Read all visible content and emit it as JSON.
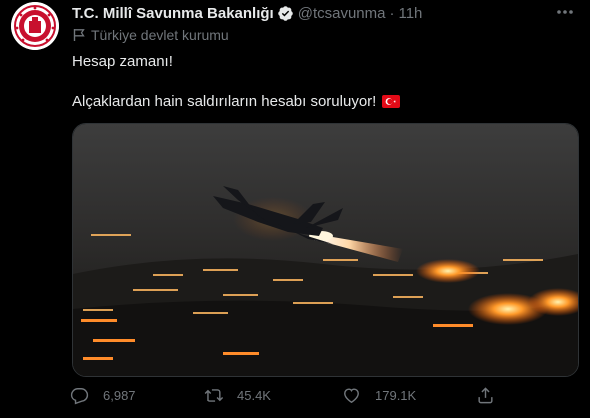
{
  "tweet": {
    "display_name": "T.C. Millî Savunma Bakanlığı",
    "handle": "@tcsavunma",
    "separator": "·",
    "time": "11h",
    "account_label": "Türkiye devlet kurumu",
    "text_line1": "Hesap zamanı!",
    "text_line2": "Alçaklardan hain saldırıların hesabı soruluyor!",
    "emoji": "turkey-flag"
  },
  "metrics": {
    "replies": "6,987",
    "retweets": "45.4K",
    "likes": "179.1K"
  },
  "icons": {
    "verified": "verified-badge-icon",
    "more": "more-options-icon",
    "label": "flag-label-icon",
    "reply": "reply-icon",
    "retweet": "retweet-icon",
    "like": "heart-icon",
    "share": "share-icon"
  },
  "colors": {
    "background": "#000000",
    "text": "#e7e9ea",
    "muted": "#71767b",
    "verified": "#e7e9ea",
    "flag_red": "#e30a17"
  }
}
